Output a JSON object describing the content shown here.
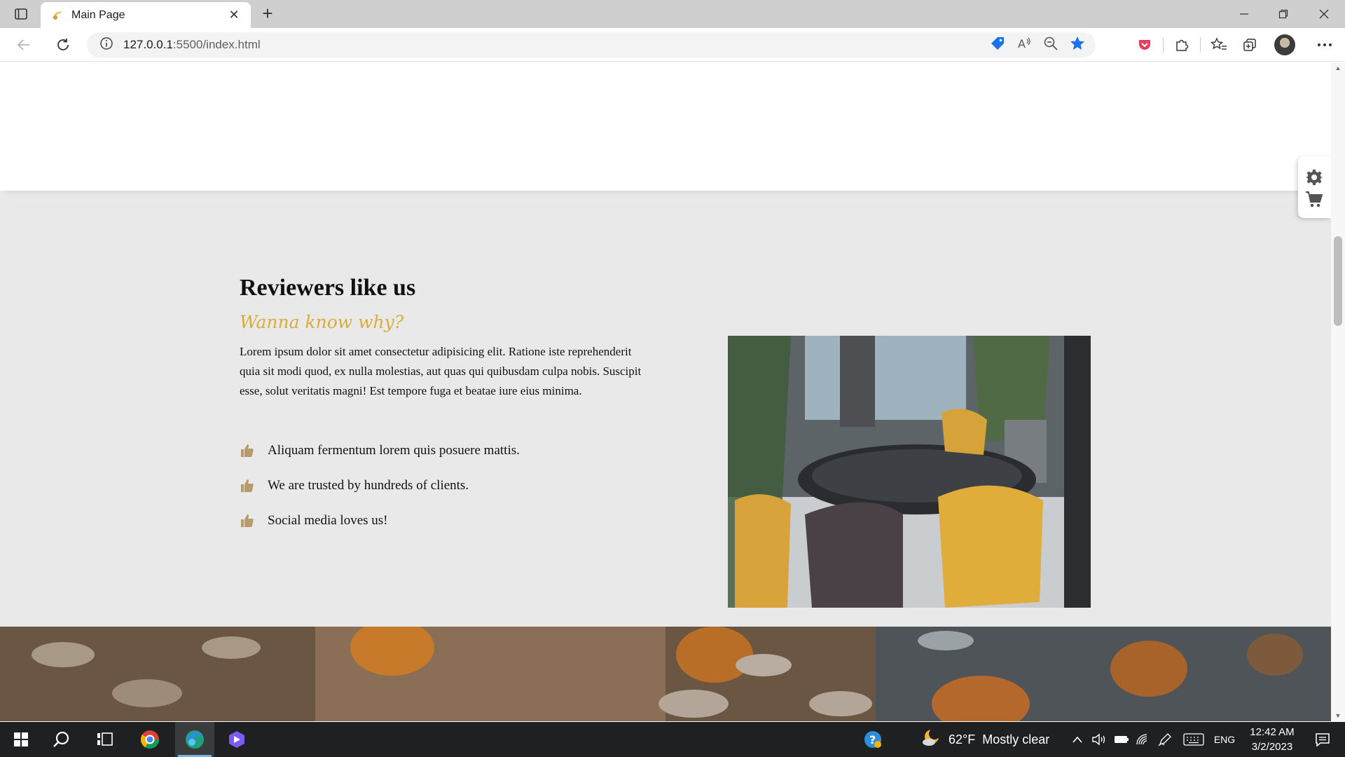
{
  "browser": {
    "tab_title": "Main Page",
    "url_host": "127.0.0.1",
    "url_rest": ":5500/index.html",
    "accent": "#1a73e8"
  },
  "icons": {
    "tab_actions": "tab-actions-icon",
    "favicon": "favicon-icon",
    "back": "back-arrow-icon",
    "refresh": "refresh-icon",
    "info": "info-icon",
    "tag": "price-tag-icon",
    "read_aloud": "read-aloud-icon",
    "zoom": "zoom-out-icon",
    "favorite": "star-filled-icon",
    "extensions": "puzzle-icon",
    "favorites": "favorites-list-icon",
    "collections": "collections-icon",
    "more": "more-dots-icon",
    "settings": "gear-icon",
    "cart": "cart-icon",
    "thumbs": "thumbs-up-icon"
  },
  "section": {
    "title": "Reviewers like us",
    "subtitle": "Wanna know why?",
    "paragraph": "Lorem ipsum dolor sit amet consectetur adipisicing elit. Ratione iste reprehenderit quia sit modi quod, ex nulla molestias, aut quas qui quibusdam culpa nobis. Suscipit esse, solut veritatis magni! Est tempore fuga et beatae iure eius minima.",
    "points": [
      "Aliquam fermentum lorem quis posuere mattis.",
      "We are trusted by hundreds of clients.",
      "Social media loves us!"
    ],
    "accent": "#d8ad3a",
    "background": "#e9e9e9"
  },
  "taskbar": {
    "weather_temp": "62°F",
    "weather_text": "Mostly clear",
    "lang": "ENG",
    "time": "12:42 AM",
    "date": "3/2/2023"
  }
}
